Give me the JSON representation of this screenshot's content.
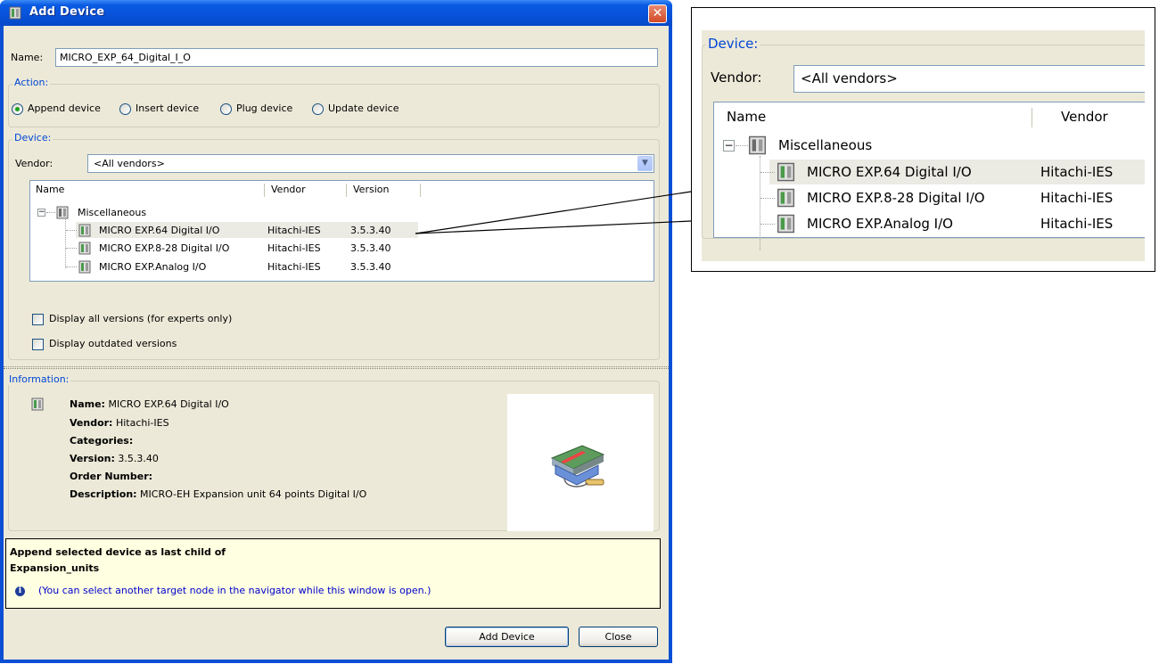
{
  "window": {
    "title": "Add Device",
    "close_glyph": "✕"
  },
  "name_field": {
    "label": "Name:",
    "value": "MICRO_EXP_64_Digital_I_O"
  },
  "action": {
    "group_label": "Action:",
    "options": [
      {
        "label": "Append device",
        "selected": true
      },
      {
        "label": "Insert device",
        "selected": false
      },
      {
        "label": "Plug device",
        "selected": false
      },
      {
        "label": "Update device",
        "selected": false
      }
    ]
  },
  "device": {
    "group_label": "Device:",
    "vendor_label": "Vendor:",
    "vendor_value": "<All vendors>",
    "columns": [
      "Name",
      "Vendor",
      "Version"
    ],
    "category": "Miscellaneous",
    "items": [
      {
        "name": "MICRO EXP.64 Digital I/O",
        "vendor": "Hitachi-IES",
        "version": "3.5.3.40",
        "selected": true
      },
      {
        "name": "MICRO EXP.8-28 Digital I/O",
        "vendor": "Hitachi-IES",
        "version": "3.5.3.40",
        "selected": false
      },
      {
        "name": "MICRO EXP.Analog I/O",
        "vendor": "Hitachi-IES",
        "version": "3.5.3.40",
        "selected": false
      }
    ],
    "checkboxes": [
      {
        "label": "Display all versions (for experts only)",
        "checked": false
      },
      {
        "label": "Display outdated versions",
        "checked": false
      }
    ]
  },
  "information": {
    "group_label": "Information:",
    "name_key": "Name:",
    "name_val": "MICRO EXP.64 Digital I/O",
    "vendor_key": "Vendor:",
    "vendor_val": "Hitachi-IES",
    "categories_key": "Categories:",
    "version_key": "Version:",
    "version_val": "3.5.3.40",
    "order_key": "Order Number:",
    "description_key": "Description:",
    "description_val": "MICRO-EH Expansion unit 64 points Digital I/O"
  },
  "hint": {
    "line1": "Append selected device as last child of",
    "line2": "Expansion_units",
    "note": "(You can select another target node in the navigator while this window is open.)"
  },
  "buttons": {
    "add": "Add Device",
    "close": "Close"
  },
  "zoom": {
    "group_label": "Device:",
    "vendor_label": "Vendor:",
    "vendor_value": "<All vendors>",
    "columns": [
      "Name",
      "Vendor"
    ]
  },
  "colors": {
    "title_bar": "#0752d8",
    "dialog_bg": "#ece9d8",
    "group_label": "#0046d5",
    "selection": "#ebeae3",
    "hint_bg": "#ffffe1"
  }
}
